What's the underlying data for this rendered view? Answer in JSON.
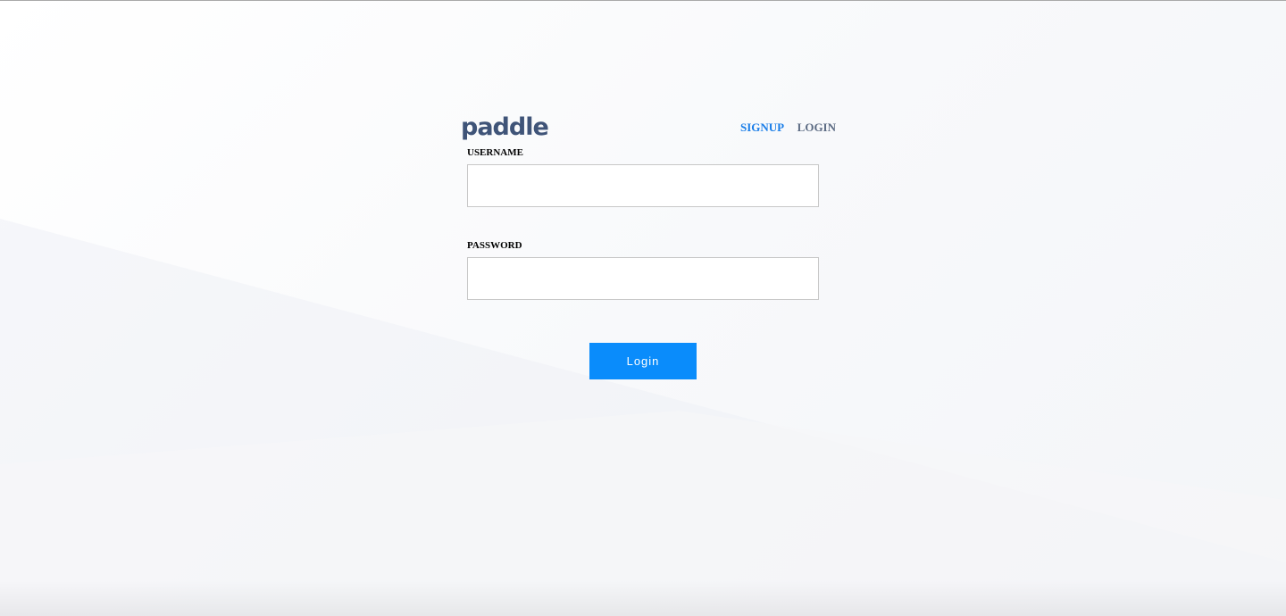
{
  "brand": {
    "logo_text": "paddle",
    "logo_color": "#3f5478"
  },
  "nav": {
    "signup_label": "SIGNUP",
    "login_label": "LOGIN",
    "signup_color": "#1a7ee8",
    "login_color": "#5d6c84"
  },
  "form": {
    "username_label": "USERNAME",
    "username_value": "",
    "username_placeholder": "",
    "password_label": "PASSWORD",
    "password_value": "",
    "password_placeholder": "",
    "submit_label": "Login",
    "submit_color": "#0a8cfb"
  }
}
